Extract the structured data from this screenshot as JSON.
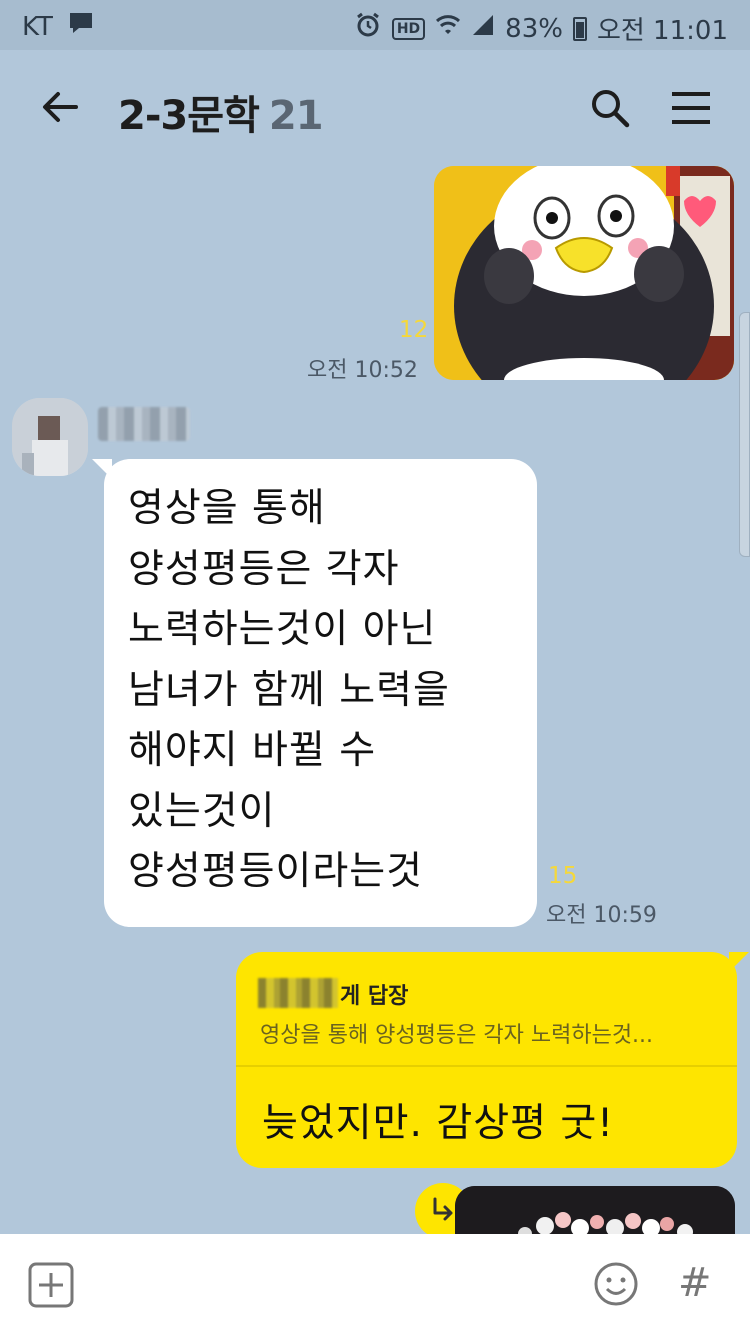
{
  "status_bar": {
    "carrier": "KT",
    "battery_percent": "83%",
    "time": "오전 11:01",
    "hd_label": "HD",
    "icons": [
      "chat-notification-icon",
      "alarm-icon",
      "hd-badge-icon",
      "wifi-icon",
      "signal-icon",
      "battery-icon"
    ]
  },
  "header": {
    "title": "2-3문학",
    "member_count": "21",
    "icons": [
      "back-arrow-icon",
      "search-icon",
      "menu-icon"
    ]
  },
  "messages": {
    "m1": {
      "type": "image",
      "sender": "me",
      "unread": "12",
      "time": "오전 10:52"
    },
    "m2": {
      "type": "text",
      "sender": "other",
      "lines": [
        "영상을 통해",
        "양성평등은 각자",
        "노력하는것이 아닌",
        "남녀가 함께 노력을",
        "해야지 바뀔 수",
        "있는것이",
        "양성평등이라는것"
      ],
      "unread": "15",
      "time": "오전 10:59"
    },
    "m3": {
      "type": "reply",
      "sender": "me",
      "reply_to_label": "게 답장",
      "reply_snippet": "영상을 통해 양성평등은 각자 노력하는것...",
      "text": "늦었지만. 감상평 굿!"
    }
  },
  "bottom_bar": {
    "icons": [
      "add-icon",
      "emoji-icon",
      "hashtag-icon"
    ],
    "hash_glyph": "#"
  },
  "colors": {
    "chat_background": "#b2c7da",
    "my_bubble": "#fee500",
    "other_bubble": "#ffffff",
    "unread_count": "#f5d83a"
  }
}
